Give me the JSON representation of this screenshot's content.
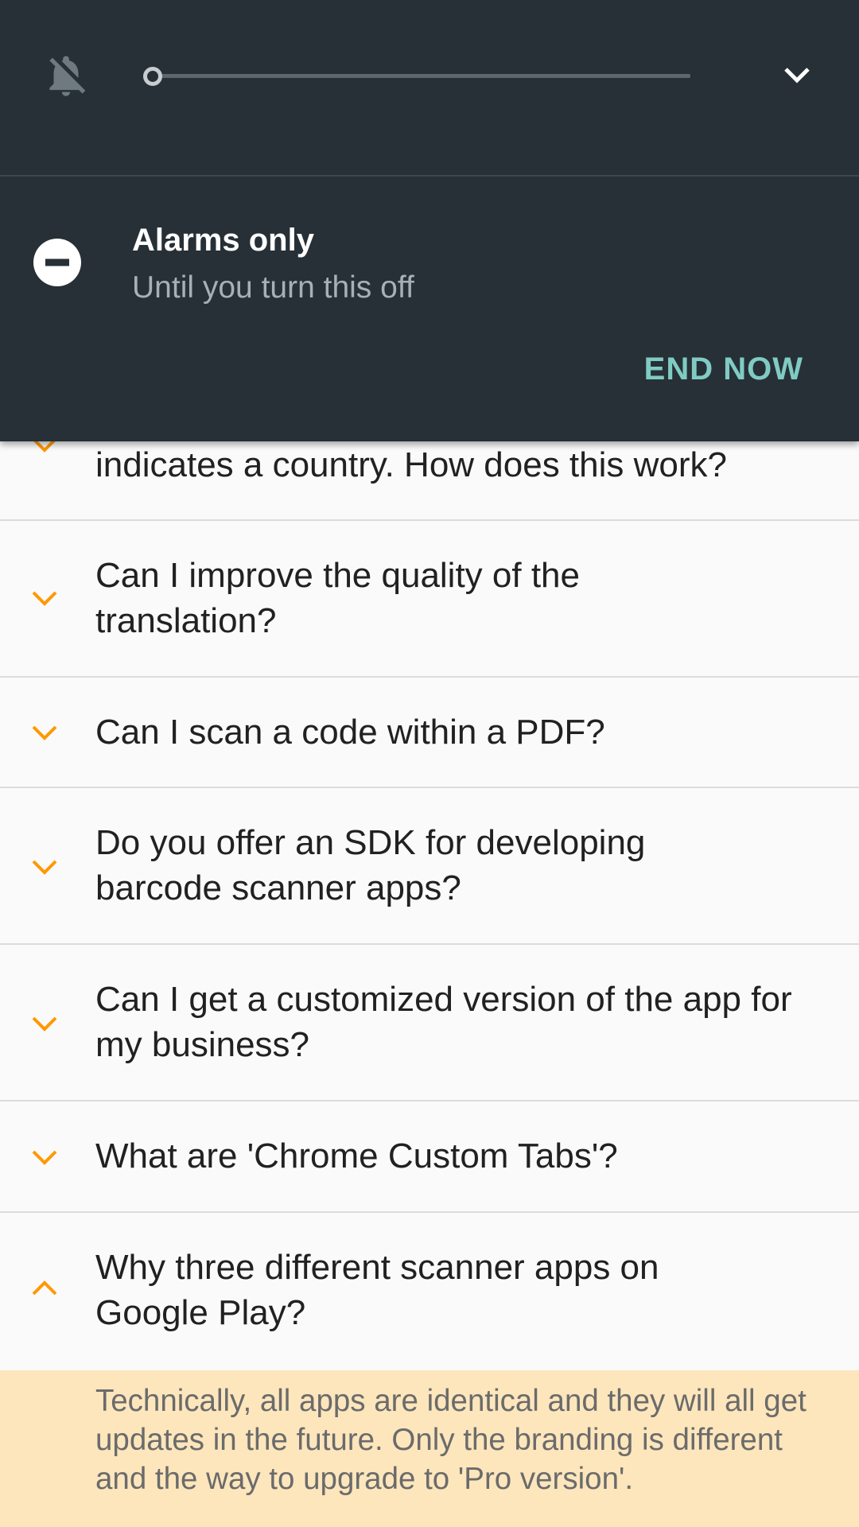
{
  "dnd": {
    "mode_title": "Alarms only",
    "mode_subtitle": "Until you turn this off",
    "end_now_label": "END NOW",
    "volume_level": 0
  },
  "faq": {
    "items": [
      {
        "question": "indicates a country. How does this work?",
        "expanded": false
      },
      {
        "question": "Can I improve the quality of the translation?",
        "expanded": false
      },
      {
        "question": "Can I scan a code within a PDF?",
        "expanded": false
      },
      {
        "question": "Do you offer an SDK for developing barcode scanner apps?",
        "expanded": false
      },
      {
        "question": "Can I get a customized version of the app for my business?",
        "expanded": false
      },
      {
        "question": "What are 'Chrome Custom Tabs'?",
        "expanded": false
      },
      {
        "question": "Why three different scanner apps on Google Play?",
        "expanded": true
      }
    ],
    "answer": "Technically, all apps are identical and they will all get updates in the future. Only the branding is different and the way to upgrade to 'Pro version'."
  },
  "colors": {
    "panel_bg": "#263036",
    "accent_teal": "#80cbc4",
    "chevron_orange": "#ff9800",
    "answer_bg": "#fde6bc"
  },
  "icons": {
    "ringer": "bell-off-icon",
    "collapse": "chevron-down-icon",
    "mode": "do-not-disturb-icon",
    "faq_collapsed": "chevron-down-icon",
    "faq_expanded": "chevron-up-icon"
  }
}
